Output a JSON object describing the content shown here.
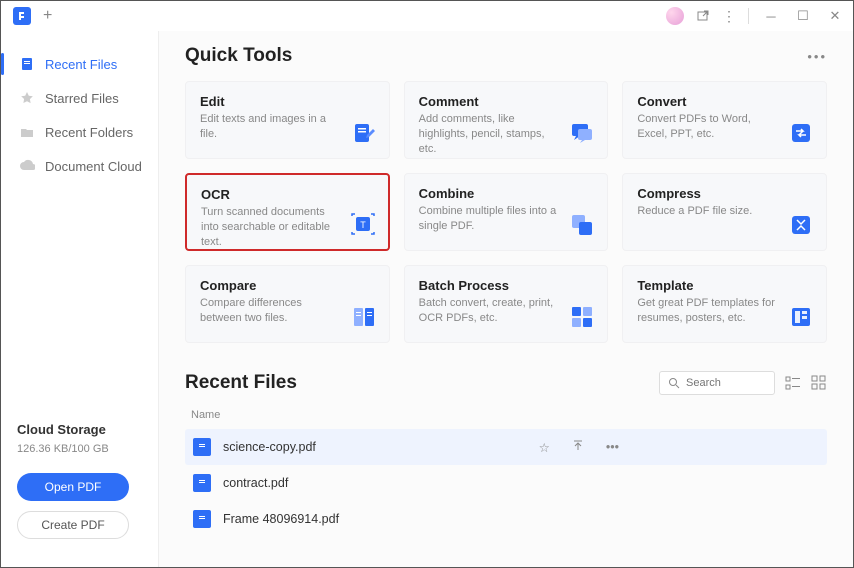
{
  "sidebar": {
    "nav": [
      {
        "label": "Recent Files"
      },
      {
        "label": "Starred Files"
      },
      {
        "label": "Recent Folders"
      },
      {
        "label": "Document Cloud"
      }
    ],
    "cloud": {
      "title": "Cloud Storage",
      "usage": "126.36 KB/100 GB"
    },
    "open_btn": "Open PDF",
    "create_btn": "Create PDF"
  },
  "quick_tools": {
    "title": "Quick Tools",
    "cards": [
      {
        "title": "Edit",
        "desc": "Edit texts and images in a file."
      },
      {
        "title": "Comment",
        "desc": "Add comments, like highlights, pencil, stamps, etc."
      },
      {
        "title": "Convert",
        "desc": "Convert PDFs to Word, Excel, PPT, etc."
      },
      {
        "title": "OCR",
        "desc": "Turn scanned documents into searchable or editable text."
      },
      {
        "title": "Combine",
        "desc": "Combine multiple files into a single PDF."
      },
      {
        "title": "Compress",
        "desc": "Reduce a PDF file size."
      },
      {
        "title": "Compare",
        "desc": "Compare differences between two files."
      },
      {
        "title": "Batch Process",
        "desc": "Batch convert, create, print, OCR PDFs, etc."
      },
      {
        "title": "Template",
        "desc": "Get great PDF templates for resumes, posters, etc."
      }
    ]
  },
  "recent": {
    "title": "Recent Files",
    "search_placeholder": "Search",
    "col_name": "Name",
    "files": [
      {
        "name": "science-copy.pdf"
      },
      {
        "name": "contract.pdf"
      },
      {
        "name": "Frame 48096914.pdf"
      }
    ]
  }
}
